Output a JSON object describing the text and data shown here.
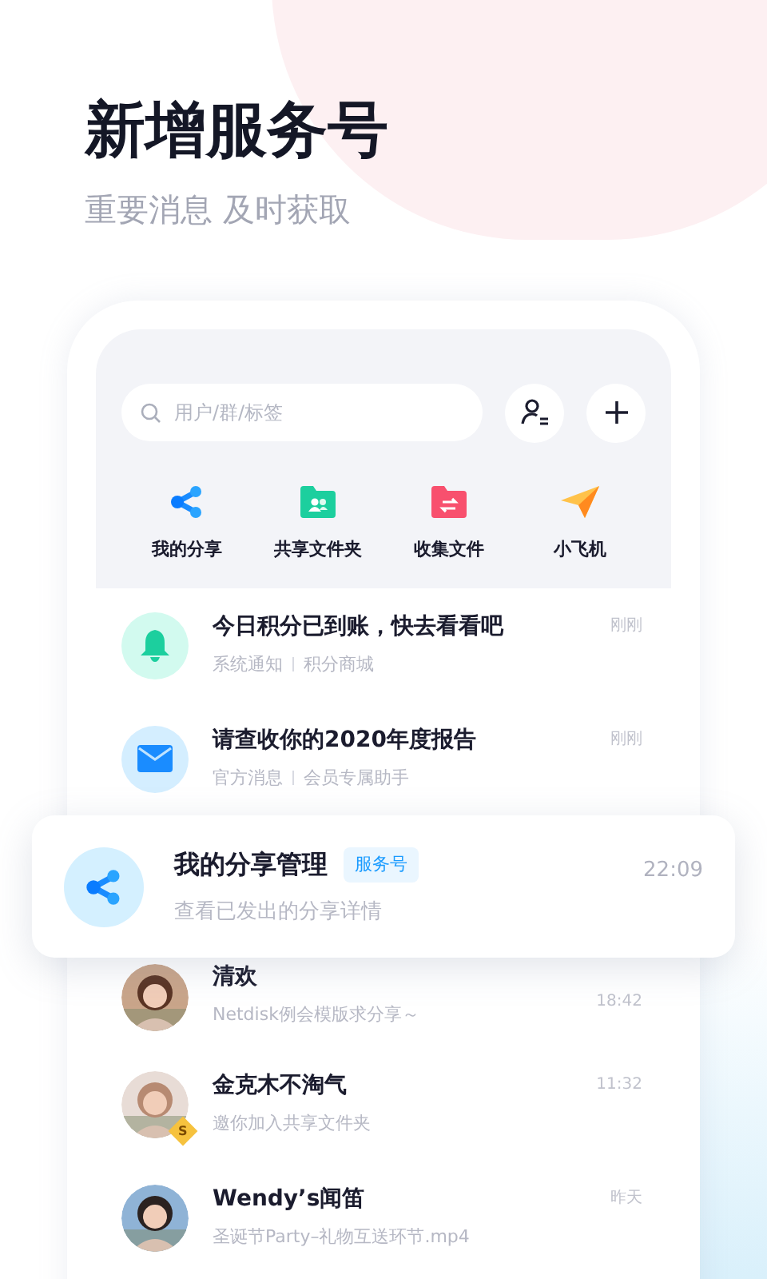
{
  "headline": "新增服务号",
  "subheadline": "重要消息 及时获取",
  "search": {
    "placeholder": "用户/群/标签"
  },
  "shortcuts": [
    {
      "kind": "share",
      "label": "我的分享"
    },
    {
      "kind": "shared_folder",
      "label": "共享文件夹"
    },
    {
      "kind": "collect",
      "label": "收集文件"
    },
    {
      "kind": "plane",
      "label": "小飞机"
    }
  ],
  "messages": [
    {
      "kind": "bell",
      "title": "今日积分已到账，快去看看吧",
      "subtitle": "系统通知",
      "source": "积分商城",
      "time": "刚刚"
    },
    {
      "kind": "mail",
      "title": "请查收你的2020年度报告",
      "subtitle": "官方消息",
      "source": "会员专属助手",
      "time": "刚刚"
    },
    {
      "kind": "service",
      "title": "我的分享管理",
      "tag": "服务号",
      "subtitle": "查看已发出的分享详情",
      "time": "22:09"
    },
    {
      "kind": "person",
      "title": "清欢",
      "subtitle": "Netdisk例会模版求分享～",
      "time": "18:42"
    },
    {
      "kind": "person",
      "title": "金克木不淘气",
      "badge": "S",
      "subtitle": "邀你加入共享文件夹",
      "time": "11:32"
    },
    {
      "kind": "person",
      "title": "Wendy’s闻笛",
      "subtitle": "圣诞节Party–礼物互送环节.mp4",
      "time": "昨天"
    }
  ]
}
